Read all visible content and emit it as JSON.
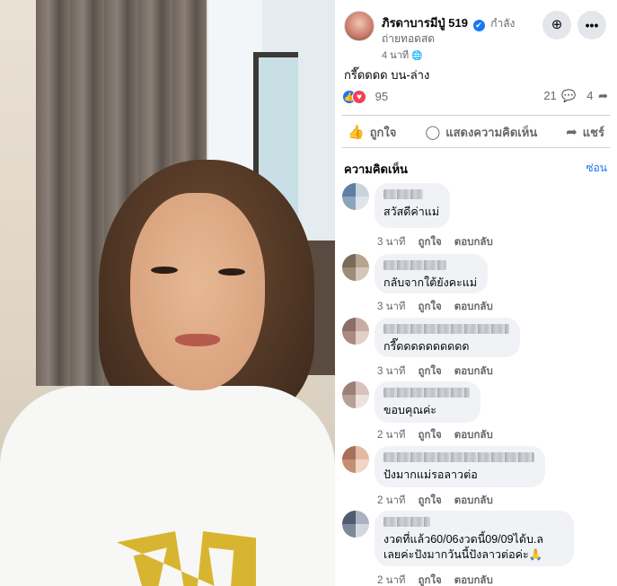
{
  "post": {
    "page_name": "ภิรดาบารมีปู่ 519",
    "verified_mark": "✔",
    "status_line1": "กำลัง",
    "status_line2": "ถ่ายทอดสด",
    "time": "4 นาที",
    "globe_icon": "🌐",
    "text": "กรี๊ดดดด บน-ล่าง",
    "reactions_count": "95",
    "comments_count": "21",
    "shares_count": "4"
  },
  "header_buttons": {
    "save_icon": "⊕",
    "more_icon": "•••"
  },
  "actions": {
    "like": "ถูกใจ",
    "comment": "แสดงความคิดเห็น",
    "share": "แชร์"
  },
  "comments_section": {
    "title": "ความคิดเห็น",
    "hide": "ซ่อน",
    "meta_like": "ถูกใจ",
    "meta_reply": "ตอบกลับ",
    "items": [
      {
        "text": "สวัสดีค่าแม่",
        "time": "3 นาที"
      },
      {
        "text": "กลับจากใต้ยังคะแม่",
        "time": "3 นาที"
      },
      {
        "text": "กรี๊ดดดดดดดดดด",
        "time": "3 นาที"
      },
      {
        "text": "ขอบคุณค่ะ",
        "time": "2 นาที"
      },
      {
        "text": "ปังมากแม่รอลาวต่อ",
        "time": "2 นาที"
      },
      {
        "text": "งวดที่แล้ว60/06งวดนี้09/09ได้บ.ล",
        "text2": "เลยค่ะปังมากวันนี้ปังลาวต่อค่ะ🙏",
        "time": "2 นาที"
      }
    ]
  },
  "colors": {
    "accent": "#1877f2",
    "love": "#f33e58",
    "bubble": "#f0f2f5",
    "secondary_text": "#65676b"
  }
}
